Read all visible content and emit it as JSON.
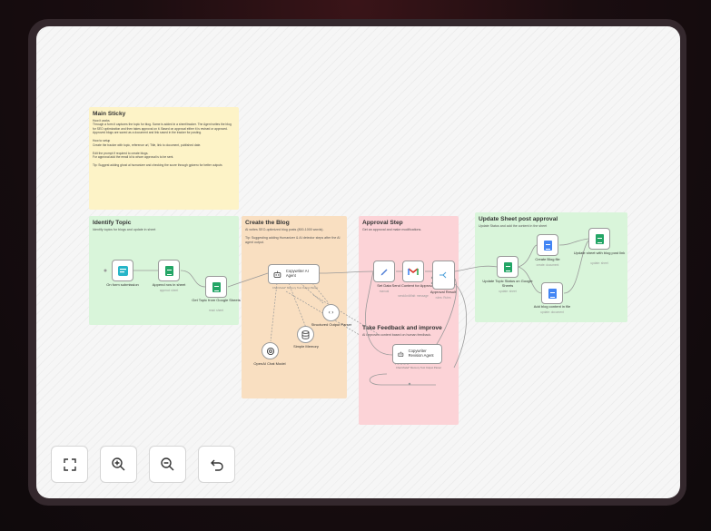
{
  "stickies": {
    "main": {
      "title": "Main Sticky",
      "body": "How it works\nThrough a form it captures the topic for blog. Same is added in a sheet/tracker. The Agent writes the blog for SEO optimization and then takes approval on it. Based on approval either it is revised or approved. Approved blogs are saved as a document and link saved in the tracker for posting.\n\nHow to setup\nCreate the tracker with topic, reference url, Title, link to document, published date.\n\nEdit the prompt if required to create blogs.\nFor approval add the email id to whom approval is to be sent.\n\nTip: Suggest adding ghost ai humanizer and checking the score through gptzero for better outputs"
    },
    "identify": {
      "title": "Identify Topic",
      "sub": "Identify topics for blogs and update in sheet"
    },
    "create": {
      "title": "Create the Blog",
      "sub": "AI writes SEO-optimized blog posts (800-1000 words).\n\nTip: Suggesting adding Humanizer & AI detector steps after the AI agent output."
    },
    "approval": {
      "title": "Approval Step",
      "sub": "Get an approval and make modifications."
    },
    "feedback": {
      "title": "Take Feedback and improve",
      "sub": "AI improves content based on human feedback."
    },
    "update": {
      "title": "Update Sheet post approval",
      "sub": "Update Status and add the content in the sheet"
    }
  },
  "nodes": {
    "form": {
      "label": "On form submission",
      "icon": "form-trigger-icon"
    },
    "append": {
      "label": "Append row in sheet",
      "sub": "append: sheet",
      "icon": "google-sheets-icon"
    },
    "gettopic": {
      "label": "Get Topic from Google Sheets",
      "sub": "read: sheet",
      "icon": "google-sheets-icon"
    },
    "copywriter": {
      "label": "Copywriter AI Agent",
      "icon": "robot-icon"
    },
    "openai": {
      "label": "OpenAI Chat Model",
      "icon": "openai-icon"
    },
    "memory": {
      "label": "Simple Memory",
      "icon": "database-icon"
    },
    "parser": {
      "label": "Structured Output Parser",
      "icon": "code-braces-icon"
    },
    "setdata": {
      "label": "Set Data",
      "sub": "manual",
      "icon": "pencil-icon"
    },
    "send": {
      "label": "Send Content for Approval",
      "sub": "sendAndWait: message",
      "icon": "gmail-icon"
    },
    "result": {
      "label": "Approval Result",
      "sub": "rules: Rules",
      "icon": "switch-icon"
    },
    "revision": {
      "label": "Copywriter Revision Agent",
      "icon": "robot-icon"
    },
    "updatestatus": {
      "label": "Update Topic Status on Google Sheets",
      "sub": "update: sheet",
      "icon": "google-sheets-icon"
    },
    "createdoc": {
      "label": "Create Blog file",
      "sub": "create: document",
      "icon": "google-docs-icon"
    },
    "adddoc": {
      "label": "Add blog content in file",
      "sub": "update: document",
      "icon": "google-docs-icon"
    },
    "updatelink": {
      "label": "Update sheet with blog post link",
      "sub": "update: sheet",
      "icon": "google-sheets-icon"
    }
  },
  "handles": {
    "agent_handles": "Chat Model*    Memory    Tool    Output Parser",
    "output_parser": "Output Parser"
  },
  "controls": {
    "fit": {
      "icon": "fit-view-icon"
    },
    "zoom_in": {
      "icon": "zoom-in-icon"
    },
    "zoom_out": {
      "icon": "zoom-out-icon"
    },
    "undo": {
      "icon": "undo-icon"
    }
  },
  "colors": {
    "sheets": "#23a566",
    "docs": "#4285f4",
    "agent_border": "#9a9a9a"
  }
}
